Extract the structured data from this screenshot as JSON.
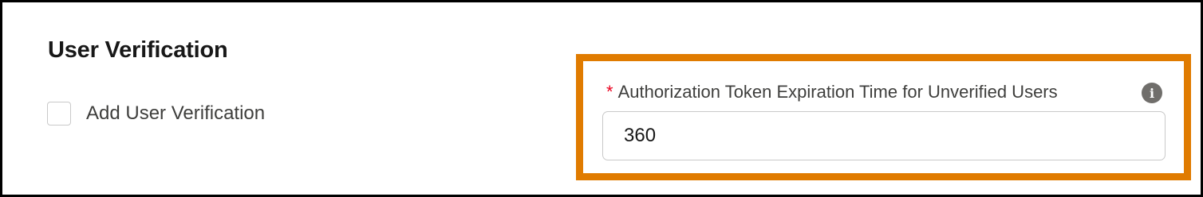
{
  "section": {
    "title": "User Verification"
  },
  "checkbox": {
    "label": "Add User Verification",
    "checked": false
  },
  "field": {
    "required_marker": "*",
    "label": "Authorization Token Expiration Time for Unverified Users",
    "value": "360",
    "info_icon": "info-icon",
    "info_glyph": "i"
  },
  "colors": {
    "highlight": "#e07b00",
    "required": "#ea001e",
    "info_icon_bg": "#706e6b"
  }
}
